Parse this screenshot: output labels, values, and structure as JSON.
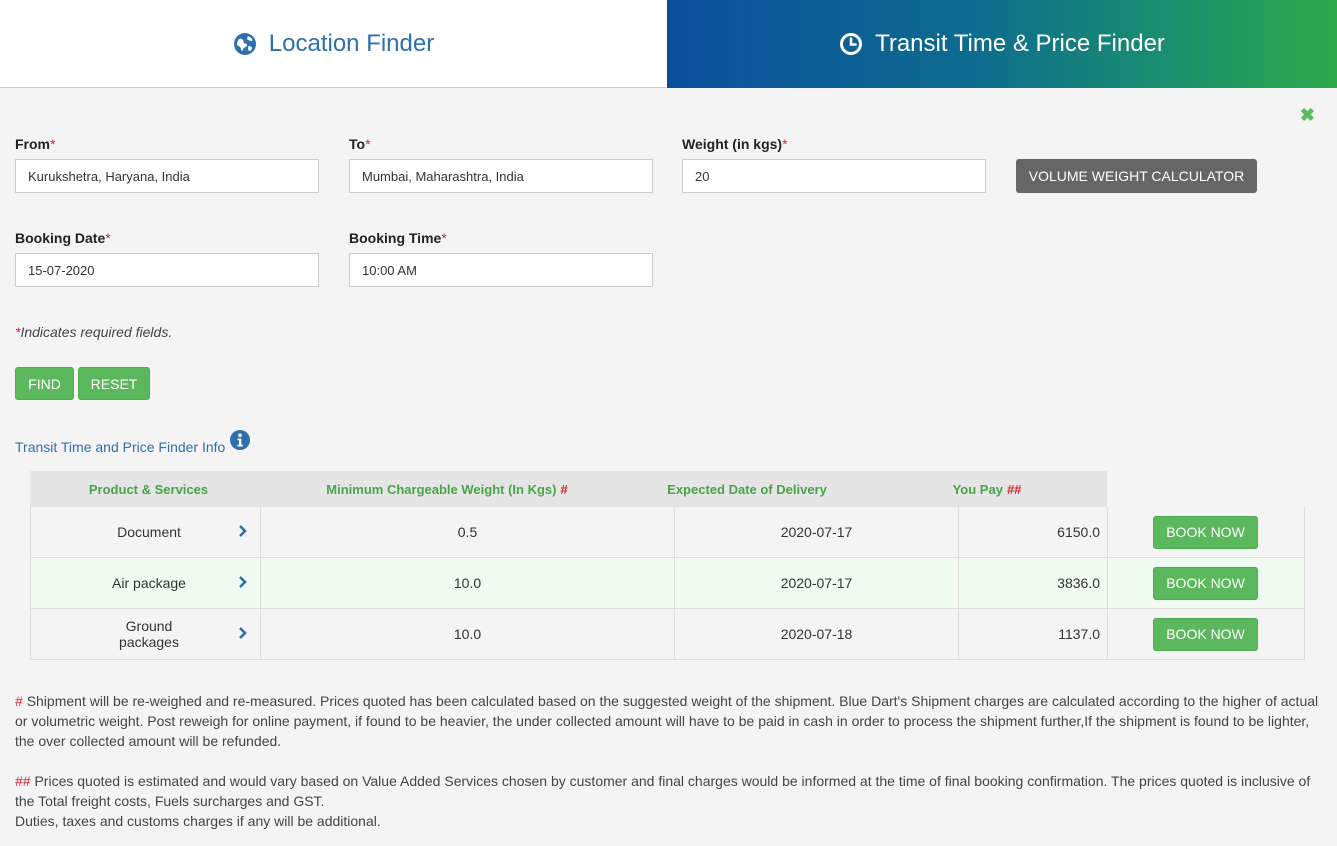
{
  "tabs": {
    "location": {
      "label": "Location Finder",
      "icon": "globe-icon"
    },
    "transit": {
      "label": "Transit Time & Price Finder",
      "icon": "clock-icon",
      "active": true
    }
  },
  "close": {
    "label": "✖",
    "icon": "close-icon"
  },
  "form": {
    "from": {
      "label": "From",
      "value": "Kurukshetra, Haryana, India"
    },
    "to": {
      "label": "To",
      "value": "Mumbai, Maharashtra, India"
    },
    "weight": {
      "label": "Weight (in kgs)",
      "value": "20"
    },
    "booking_date": {
      "label": "Booking Date",
      "value": "15-07-2020"
    },
    "booking_time": {
      "label": "Booking Time",
      "value": "10:00 AM"
    },
    "required_mark": "*",
    "required_note": "Indicates required fields.",
    "volume_calc_label": "VOLUME WEIGHT CALCULATOR",
    "find_label": "FIND",
    "reset_label": "RESET"
  },
  "info_link": {
    "label": "Transit Time and Price Finder Info",
    "icon": "info-icon"
  },
  "table": {
    "headers": {
      "product": "Product & Services",
      "weight": "Minimum Chargeable Weight (In Kgs)",
      "weight_mark": "#",
      "date": "Expected Date of Delivery",
      "pay": "You Pay",
      "pay_mark": "##"
    },
    "rows": [
      {
        "product": "Document",
        "weight": "0.5",
        "date": "2020-07-17",
        "pay": "6150.0",
        "book_label": "BOOK NOW"
      },
      {
        "product": "Air package",
        "weight": "10.0",
        "date": "2020-07-17",
        "pay": "3836.0",
        "book_label": "BOOK NOW"
      },
      {
        "product": "Ground packages",
        "weight": "10.0",
        "date": "2020-07-18",
        "pay": "1137.0",
        "book_label": "BOOK NOW"
      }
    ]
  },
  "notes": {
    "note1_mark": "#",
    "note1": "Shipment will be re-weighed and re-measured. Prices quoted has been calculated based on the suggested weight of the shipment. Blue Dart's Shipment charges are calculated according to the higher of actual or volumetric weight. Post reweigh for online payment, if found to be heavier, the under collected amount will have to be paid in cash in order to process the shipment further,If the shipment is found to be lighter, the over collected amount will be refunded.",
    "note2_mark": "##",
    "note2": "Prices quoted is estimated and would vary based on Value Added Services chosen by customer and final charges would be informed at the time of final booking confirmation. The prices quoted is inclusive of the Total freight costs, Fuels surcharges and GST.",
    "note3": "Duties, taxes and customs charges if any will be additional."
  },
  "colors": {
    "accent_green": "#5cb85c",
    "link_blue": "#2f6fad",
    "required_red": "#d9232d",
    "header_gradient_start": "#0b4f9c",
    "header_gradient_end": "#2ea84a"
  }
}
